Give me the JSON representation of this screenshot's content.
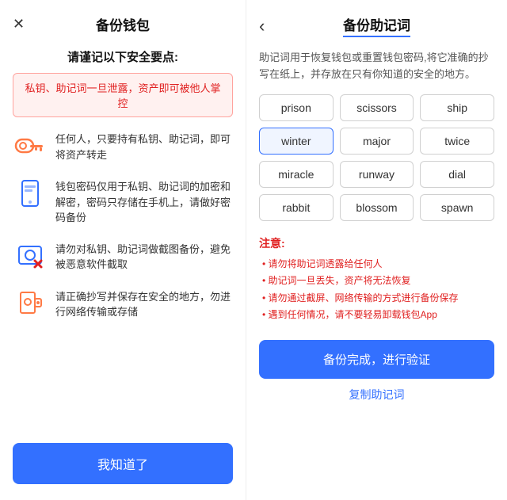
{
  "left": {
    "close_icon": "✕",
    "title": "备份钱包",
    "subtitle": "请谨记以下安全要点:",
    "warning": "私钥、助记词一旦泄露，资产即可被他人掌控",
    "security_items": [
      {
        "id": "key",
        "icon": "🔑",
        "text": "任何人，只要持有私钥、助记词，即可将资产转走"
      },
      {
        "id": "phone",
        "icon": "📱",
        "text": "钱包密码仅用于私钥、助记词的加密和解密，密码只存储在手机上，请做好密码备份"
      },
      {
        "id": "screenshot",
        "icon": "📷",
        "text": "请勿对私钥、助记词做截图备份，避免被恶意软件截取"
      },
      {
        "id": "safe",
        "icon": "🔒",
        "text": "请正确抄写并保存在安全的地方，勿进行网络传输或存储"
      }
    ],
    "confirm_button": "我知道了"
  },
  "right": {
    "back_icon": "‹",
    "title": "备份助记词",
    "description": "助记词用于恢复钱包或重置钱包密码,将它准确的抄写在纸上，并存放在只有你知道的安全的地方。",
    "words": [
      {
        "word": "prison",
        "highlighted": false
      },
      {
        "word": "scissors",
        "highlighted": false
      },
      {
        "word": "ship",
        "highlighted": false
      },
      {
        "word": "winter",
        "highlighted": true
      },
      {
        "word": "major",
        "highlighted": false
      },
      {
        "word": "twice",
        "highlighted": false
      },
      {
        "word": "miracle",
        "highlighted": false
      },
      {
        "word": "runway",
        "highlighted": false
      },
      {
        "word": "dial",
        "highlighted": false
      },
      {
        "word": "rabbit",
        "highlighted": false
      },
      {
        "word": "blossom",
        "highlighted": false
      },
      {
        "word": "spawn",
        "highlighted": false
      }
    ],
    "notes_title": "注意:",
    "notes": [
      "请勿将助记词透露给任何人",
      "助记词一旦丢失，资产将无法恢复",
      "请勿通过截屏、网络传输的方式进行备份保存",
      "遇到任何情况，请不要轻易卸载钱包App"
    ],
    "verify_button": "备份完成，进行验证",
    "copy_button": "复制助记词"
  }
}
